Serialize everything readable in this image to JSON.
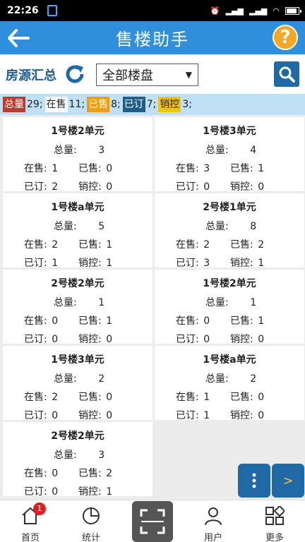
{
  "status": {
    "time": "22:26"
  },
  "appbar": {
    "title": "售楼助手",
    "help": "?"
  },
  "filter": {
    "label": "房源汇总",
    "select_value": "全部楼盘"
  },
  "summary": {
    "total_label": "总量",
    "total": "29;",
    "onsale_label": "在售",
    "onsale": "11;",
    "sold_label": "已售",
    "sold": "8;",
    "booked_label": "已订",
    "booked": "7;",
    "control_label": "销控",
    "control": "3;"
  },
  "labels": {
    "total": "总量:",
    "onsale": "在售:",
    "sold": "已售:",
    "booked": "已订:",
    "control": "销控:"
  },
  "cards": [
    {
      "name": "1号楼2单元",
      "total": "3",
      "onsale": "1",
      "sold": "0",
      "booked": "2",
      "control": "0"
    },
    {
      "name": "1号楼3单元",
      "total": "4",
      "onsale": "3",
      "sold": "1",
      "booked": "0",
      "control": "0"
    },
    {
      "name": "1号楼a单元",
      "total": "5",
      "onsale": "2",
      "sold": "1",
      "booked": "1",
      "control": "1"
    },
    {
      "name": "2号楼1单元",
      "total": "8",
      "onsale": "2",
      "sold": "2",
      "booked": "3",
      "control": "1"
    },
    {
      "name": "2号楼2单元",
      "total": "1",
      "onsale": "0",
      "sold": "1",
      "booked": "0",
      "control": "0"
    },
    {
      "name": "1号楼2单元",
      "total": "1",
      "onsale": "0",
      "sold": "1",
      "booked": "0",
      "control": "0"
    },
    {
      "name": "1号楼3单元",
      "total": "2",
      "onsale": "2",
      "sold": "0",
      "booked": "0",
      "control": "0"
    },
    {
      "name": "1号楼a单元",
      "total": "2",
      "onsale": "1",
      "sold": "0",
      "booked": "1",
      "control": "0"
    },
    {
      "name": "2号楼2单元",
      "total": "3",
      "onsale": "0",
      "sold": "2",
      "booked": "0",
      "control": "1"
    }
  ],
  "fab": {
    "next": ">"
  },
  "tabs": {
    "home": "首页",
    "home_badge": "1",
    "stats": "统计",
    "user": "用户",
    "more": "更多"
  },
  "icons": [
    "back-arrow-icon",
    "help-icon",
    "refresh-icon",
    "search-icon",
    "more-vertical-icon",
    "home-icon",
    "pie-chart-icon",
    "scan-icon",
    "user-icon",
    "grid-more-icon"
  ]
}
